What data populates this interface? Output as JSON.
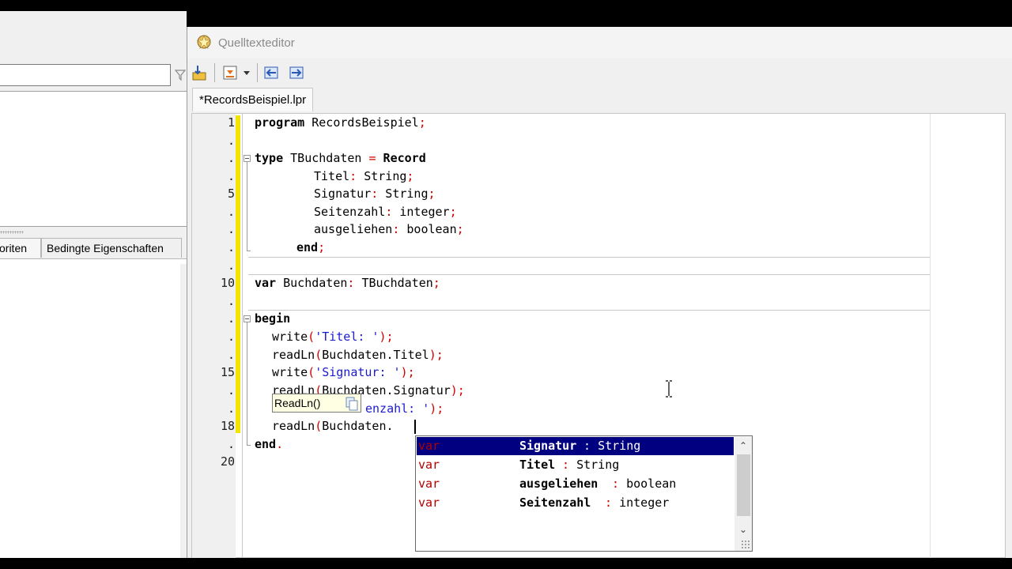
{
  "left_panel": {
    "tabs": [
      "oriten",
      "Bedingte Eigenschaften"
    ]
  },
  "editor": {
    "window_title": "Quelltexteditor",
    "file_tab": "*RecordsBeispiel.lpr",
    "gutter_labels": [
      "1",
      ".",
      ".",
      ".",
      "5",
      ".",
      ".",
      ".",
      ".",
      "10",
      ".",
      ".",
      ".",
      ".",
      "15",
      ".",
      ".",
      "18",
      ".",
      "20"
    ],
    "code": {
      "l1_kw": "program",
      "l1_rest": " RecordsBeispiel",
      "l1_end": ";",
      "l3_kw": "type",
      "l3_rest": " TBuchdaten ",
      "l3_eq": "=",
      "l3_kw2": " Record",
      "l4_a": "Titel",
      "l4_colon": ":",
      "l4_b": " String",
      "l4_end": ";",
      "l5_a": "Signatur",
      "l5_colon": ":",
      "l5_b": " String",
      "l5_end": ";",
      "l6_a": "Seitenzahl",
      "l6_colon": ":",
      "l6_b": " integer",
      "l6_end": ";",
      "l7_a": "ausgeliehen",
      "l7_colon": ":",
      "l7_b": " boolean",
      "l7_end": ";",
      "l8_kw": "end",
      "l8_end": ";",
      "l10_kw": "var",
      "l10_a": " Buchdaten",
      "l10_colon": ":",
      "l10_b": " TBuchdaten",
      "l10_end": ";",
      "l12_kw": "begin",
      "l13_fn": "write",
      "l13_open": "(",
      "l13_str": "'Titel: '",
      "l13_close": ");",
      "l14_fn": "readLn",
      "l14_open": "(",
      "l14_arg": "Buchdaten.Titel",
      "l14_close": ");",
      "l15_fn": "write",
      "l15_open": "(",
      "l15_str": "'Signatur: '",
      "l15_close": ");",
      "l16_fn": "readLn",
      "l16_open": "(",
      "l16_arg": "Buchdaten.Signatur",
      "l16_close": ");",
      "l17_str": "enzahl: '",
      "l17_close": ");",
      "l18_fn": "readLn",
      "l18_open": "(",
      "l18_arg": "Buchdaten.",
      "l19_kw": "end",
      "l19_end": "."
    },
    "hint": "ReadLn()"
  },
  "completion": {
    "items": [
      {
        "kind": "var",
        "name": "Signatur",
        "sep": " : ",
        "type": "String",
        "selected": true
      },
      {
        "kind": "var",
        "name": "Titel",
        "sep": " : ",
        "type": "String",
        "selected": false
      },
      {
        "kind": "var",
        "name": "ausgeliehen",
        "sep": " : ",
        "type": "boolean",
        "selected": false
      },
      {
        "kind": "var",
        "name": "Seitenzahl",
        "sep": " : ",
        "type": "integer",
        "selected": false
      }
    ]
  },
  "colors": {
    "selection": "#000080",
    "keyword_symbol": "#d00000",
    "string": "#1a1ad0",
    "modified_marker": "#f2e400",
    "hint_bg": "#ffffe4"
  }
}
